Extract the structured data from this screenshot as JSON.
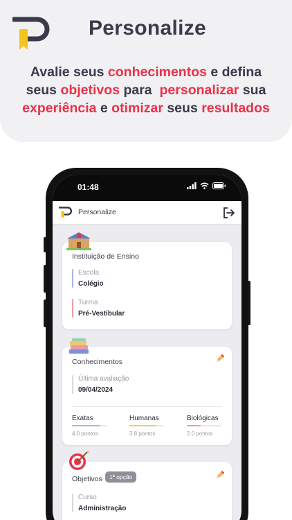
{
  "header": {
    "brand": "Personalize",
    "tagline": [
      [
        {
          "t": "Avalie seus ",
          "h": false
        },
        {
          "t": "conhecimentos",
          "h": true
        },
        {
          "t": " e defina",
          "h": false
        }
      ],
      [
        {
          "t": "seus ",
          "h": false
        },
        {
          "t": "objetivos",
          "h": true
        },
        {
          "t": " para  ",
          "h": false
        },
        {
          "t": "personalizar",
          "h": true
        },
        {
          "t": " sua",
          "h": false
        }
      ],
      [
        {
          "t": "experiência",
          "h": true
        },
        {
          "t": " e ",
          "h": false
        },
        {
          "t": "otimizar",
          "h": true
        },
        {
          "t": " seus ",
          "h": false
        },
        {
          "t": "resultados",
          "h": true
        }
      ]
    ]
  },
  "phone": {
    "time": "01:48",
    "app_title": "Personalize"
  },
  "institution": {
    "title": "Instituição de Ensino",
    "school_label": "Escola",
    "school_value": "Colégio",
    "class_label": "Turma",
    "class_value": "Pré-Vestibular"
  },
  "knowledge": {
    "title": "Conhecimentos",
    "last_label": "Última avaliação",
    "last_value": "09/04/2024",
    "areas": [
      {
        "name": "Exatas",
        "points": "4.0 pontos",
        "level": 0.8,
        "color": "#aab4e8"
      },
      {
        "name": "Humanas",
        "points": "3.8 pontos",
        "level": 0.76,
        "color": "#f0c86e"
      },
      {
        "name": "Biológicas",
        "points": "2.0 pontos",
        "level": 0.4,
        "color": "#ee9aa6"
      }
    ]
  },
  "goals": {
    "title": "Objetivos",
    "badge": "1ª opção",
    "course_label": "Curso",
    "course_value": "Administração"
  },
  "colors": {
    "accent": "#e8334a",
    "text": "#3a3b4a",
    "logo_yellow": "#f6c21c"
  }
}
